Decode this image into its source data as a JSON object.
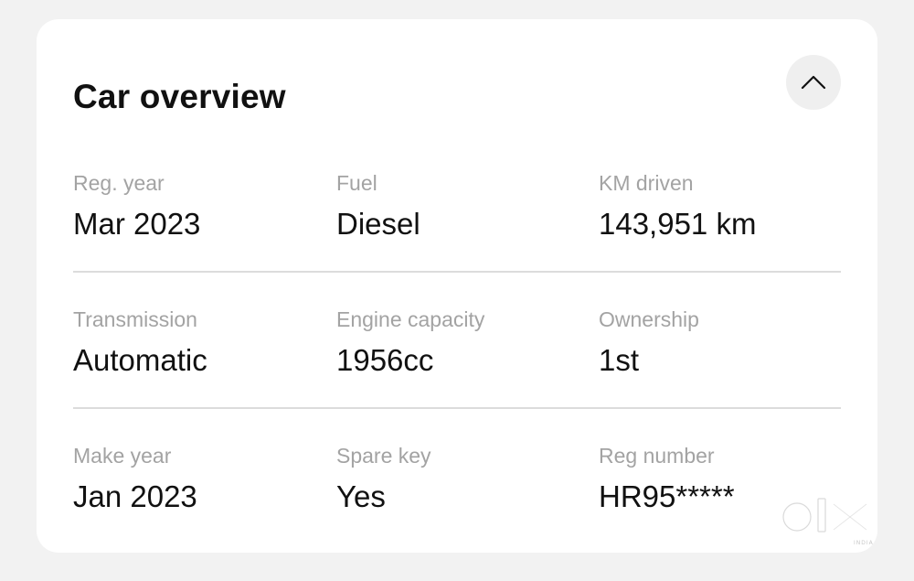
{
  "card": {
    "title": "Car overview",
    "collapse_icon": "chevron-up-icon"
  },
  "details": [
    {
      "label": "Reg. year",
      "value": "Mar 2023"
    },
    {
      "label": "Fuel",
      "value": "Diesel"
    },
    {
      "label": "KM driven",
      "value": "143,951 km"
    },
    {
      "label": "Transmission",
      "value": "Automatic"
    },
    {
      "label": "Engine capacity",
      "value": "1956cc"
    },
    {
      "label": "Ownership",
      "value": "1st"
    },
    {
      "label": "Make year",
      "value": "Jan 2023"
    },
    {
      "label": "Spare key",
      "value": "Yes"
    },
    {
      "label": "Reg number",
      "value": "HR95*****"
    }
  ],
  "watermark": {
    "brand": "olx",
    "region": "INDIA"
  },
  "colors": {
    "page_background": "#f2f2f2",
    "card_background": "#ffffff",
    "label_text": "#a3a3a3",
    "value_text": "#111111",
    "divider": "#dcdcdc",
    "button_background": "#efefef"
  }
}
